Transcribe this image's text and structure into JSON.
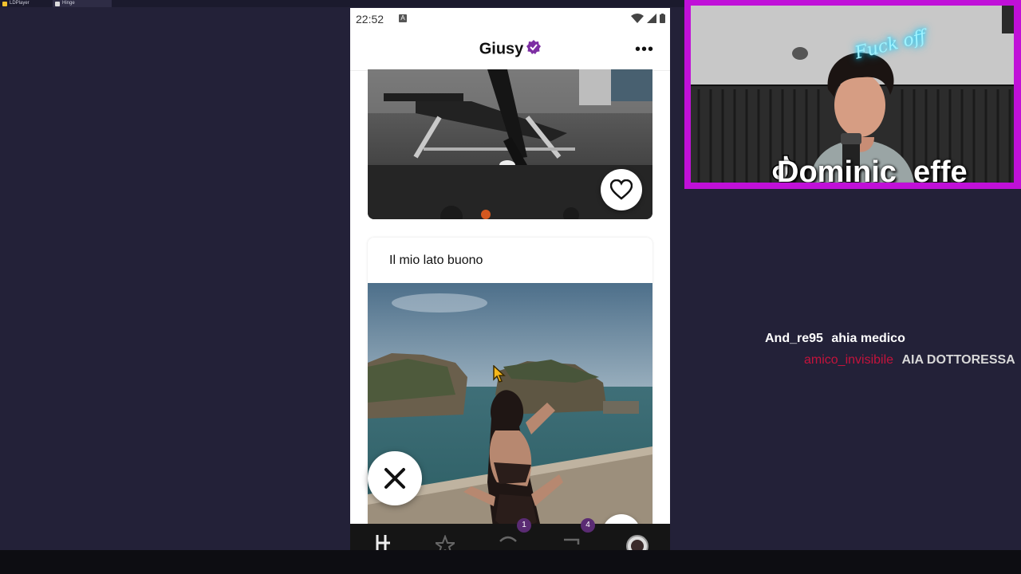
{
  "host": {
    "tabs": [
      {
        "label": "LDPlayer"
      },
      {
        "label": "Hinge"
      }
    ]
  },
  "phone": {
    "status": {
      "time": "22:52",
      "a_label": "A"
    },
    "header": {
      "name": "Giusy",
      "more_label": "•••"
    },
    "prompt": {
      "label": "Il mio lato buono"
    },
    "nav": {
      "badges": [
        {
          "count": "1"
        },
        {
          "count": "4"
        }
      ]
    }
  },
  "stream": {
    "handle": "Dominic_effe",
    "neon_sign": "Fuck off"
  },
  "chat": [
    {
      "user": "And_re95",
      "message": "ahia medico",
      "user_color": "#ffffff"
    },
    {
      "user": "amico_invisibile",
      "message": "AIA DOTTORESSA",
      "user_color": "#c4133c"
    }
  ],
  "colors": {
    "background": "#232138",
    "accent": "#5a2b73",
    "cam_border": "#c010d8"
  }
}
